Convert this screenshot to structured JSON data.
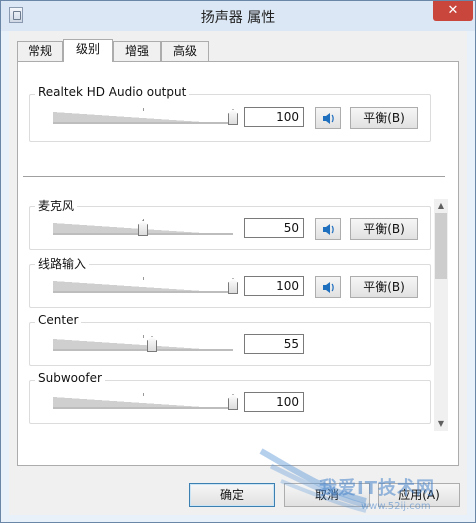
{
  "window": {
    "title": "扬声器 属性",
    "close_glyph": "✕",
    "accent": "#c9463d"
  },
  "tabs": [
    {
      "label": "常规"
    },
    {
      "label": "级别"
    },
    {
      "label": "增强"
    },
    {
      "label": "高级"
    }
  ],
  "output": {
    "label": "Realtek HD Audio output",
    "value": "100",
    "level": 1.0,
    "balance_label": "平衡(B)"
  },
  "channels": [
    {
      "label": "麦克风",
      "value": "50",
      "level": 0.5,
      "balance_label": "平衡(B)",
      "has_mute": true
    },
    {
      "label": "线路输入",
      "value": "100",
      "level": 1.0,
      "balance_label": "平衡(B)",
      "has_mute": true
    },
    {
      "label": "Center",
      "value": "55",
      "level": 0.55,
      "has_mute": false
    },
    {
      "label": "Subwoofer",
      "value": "100",
      "level": 1.0,
      "has_mute": false
    }
  ],
  "buttons": {
    "ok": "确定",
    "cancel": "取消",
    "apply": "应用(A)"
  },
  "watermark": {
    "text": "我爱IT技术网",
    "url": "www.52ij.com"
  }
}
